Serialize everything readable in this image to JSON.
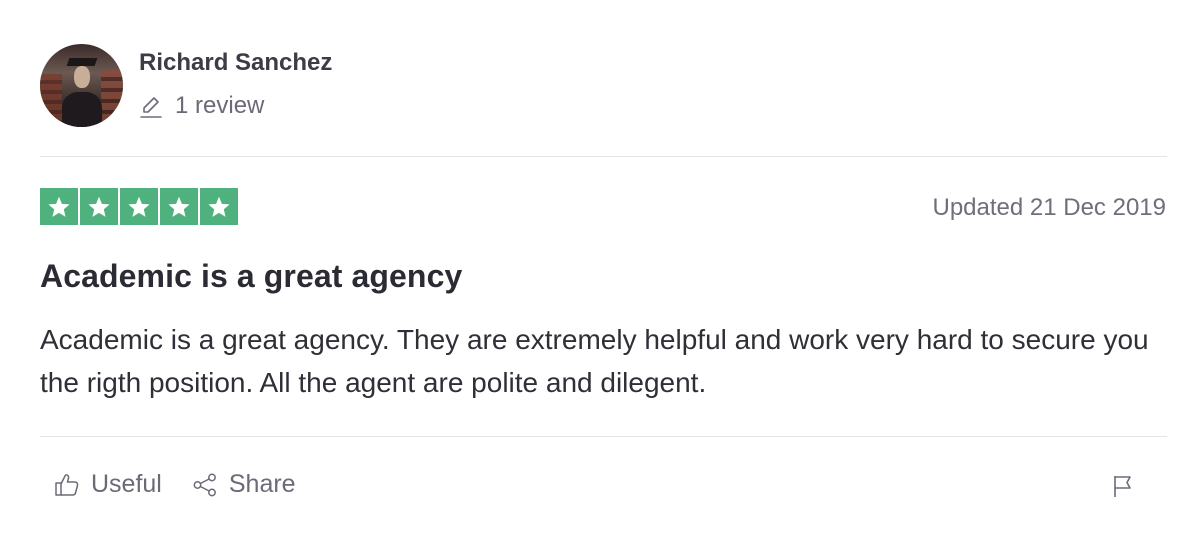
{
  "reviewer": {
    "name": "Richard Sanchez",
    "review_count": "1 review",
    "avatar_icon": "graduate-photo"
  },
  "review": {
    "rating": 5,
    "rating_max": 5,
    "star_color": "#4fb27e",
    "date": "Updated 21 Dec 2019",
    "title": "Academic is a great agency",
    "body": "Academic is a great agency. They are extremely helpful and work very hard to secure you the rigth position. All the agent are polite and dilegent."
  },
  "actions": {
    "useful_label": "Useful",
    "share_label": "Share",
    "useful_icon": "thumbs-up-icon",
    "share_icon": "share-icon",
    "flag_icon": "flag-icon"
  }
}
